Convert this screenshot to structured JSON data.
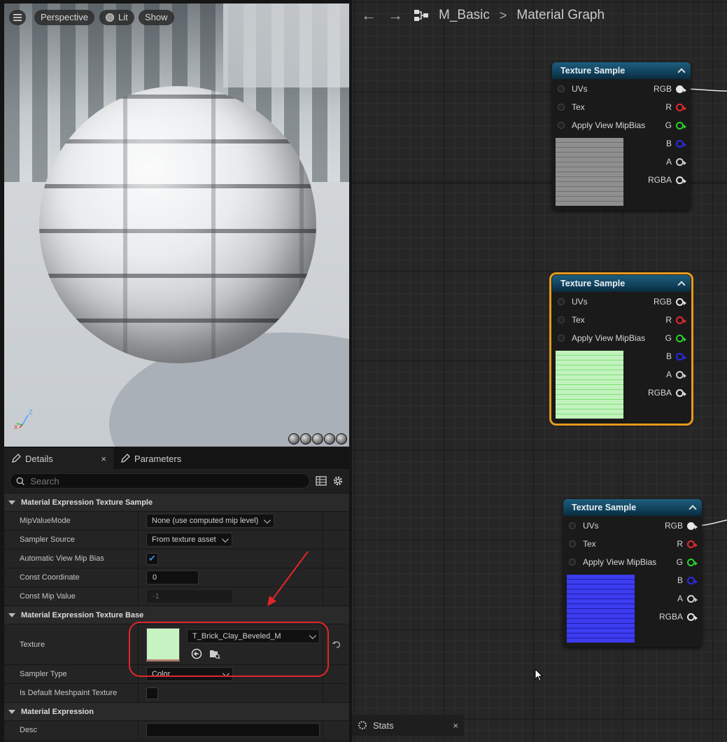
{
  "viewport": {
    "perspective_label": "Perspective",
    "lit_label": "Lit",
    "show_label": "Show",
    "axis_z": "Z",
    "axis_x": "X"
  },
  "details": {
    "tab_details": "Details",
    "tab_parameters": "Parameters",
    "close_glyph": "×",
    "search_placeholder": "Search",
    "sections": {
      "texture_sample": "Material Expression Texture Sample",
      "texture_base": "Material Expression Texture Base",
      "expression": "Material Expression"
    },
    "props": {
      "mip_value_mode": {
        "label": "MipValueMode",
        "value": "None (use computed mip level)"
      },
      "sampler_source": {
        "label": "Sampler Source",
        "value": "From texture asset"
      },
      "auto_view_mip_bias": {
        "label": "Automatic View Mip Bias",
        "checked": true
      },
      "const_coordinate": {
        "label": "Const Coordinate",
        "value": "0"
      },
      "const_mip_value": {
        "label": "Const Mip Value",
        "value": "-1"
      },
      "texture": {
        "label": "Texture",
        "value": "T_Brick_Clay_Beveled_M"
      },
      "sampler_type": {
        "label": "Sampler Type",
        "value": "Color"
      },
      "default_meshpaint": {
        "label": "Is Default Meshpaint Texture",
        "checked": false
      },
      "desc": {
        "label": "Desc",
        "value": ""
      }
    }
  },
  "graph": {
    "breadcrumb_asset": "M_Basic",
    "breadcrumb_page": "Material Graph",
    "nodes": [
      {
        "title": "Texture Sample",
        "preview": "gray-brick",
        "selected": false
      },
      {
        "title": "Texture Sample",
        "preview": "green-brick",
        "selected": true
      },
      {
        "title": "Texture Sample",
        "preview": "blue-normal",
        "selected": false
      }
    ],
    "inputs": [
      "UVs",
      "Tex",
      "Apply View MipBias"
    ],
    "outputs": [
      "RGB",
      "R",
      "G",
      "B",
      "A",
      "RGBA"
    ],
    "output_colors": [
      "#e6e6e6",
      "#e22a2a",
      "#2ad12a",
      "#2a2ae6",
      "#d0d0d0",
      "#e6e6e6"
    ]
  },
  "stats_tab": {
    "label": "Stats",
    "close_glyph": "×"
  }
}
